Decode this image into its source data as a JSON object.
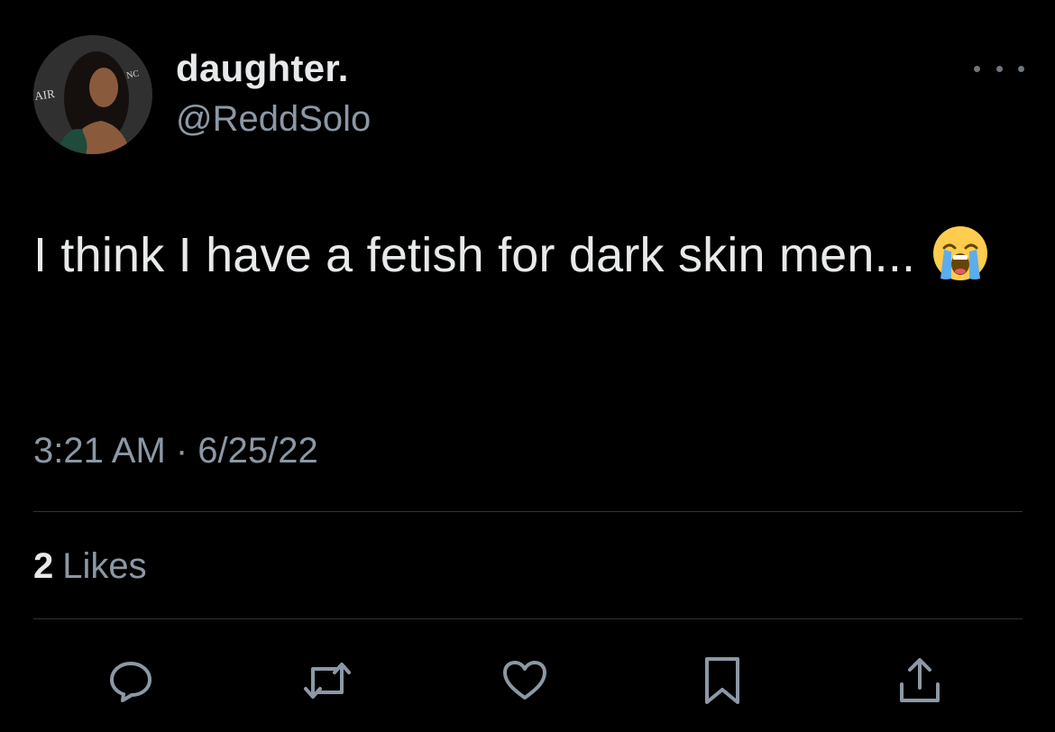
{
  "user": {
    "display_name": "daughter.",
    "handle": "@ReddSolo",
    "avatar_backdrop_text_left": "AIR",
    "avatar_backdrop_text_right": "NC"
  },
  "tweet": {
    "text": "I think I have a fetish for dark skin men...",
    "emoji": "loudly-crying-face",
    "timestamp": "3:21 AM · 6/25/22"
  },
  "engagement": {
    "likes_count": "2",
    "likes_label": "Likes"
  },
  "actions": {
    "reply_icon": "reply-icon",
    "retweet_icon": "retweet-icon",
    "like_icon": "heart-icon",
    "bookmark_icon": "bookmark-icon",
    "share_icon": "share-icon"
  },
  "colors": {
    "background": "#000000",
    "primary_text": "#e7e9ea",
    "secondary_text": "#8b98a5",
    "divider": "#2f3336",
    "icon": "#8b98a5"
  }
}
